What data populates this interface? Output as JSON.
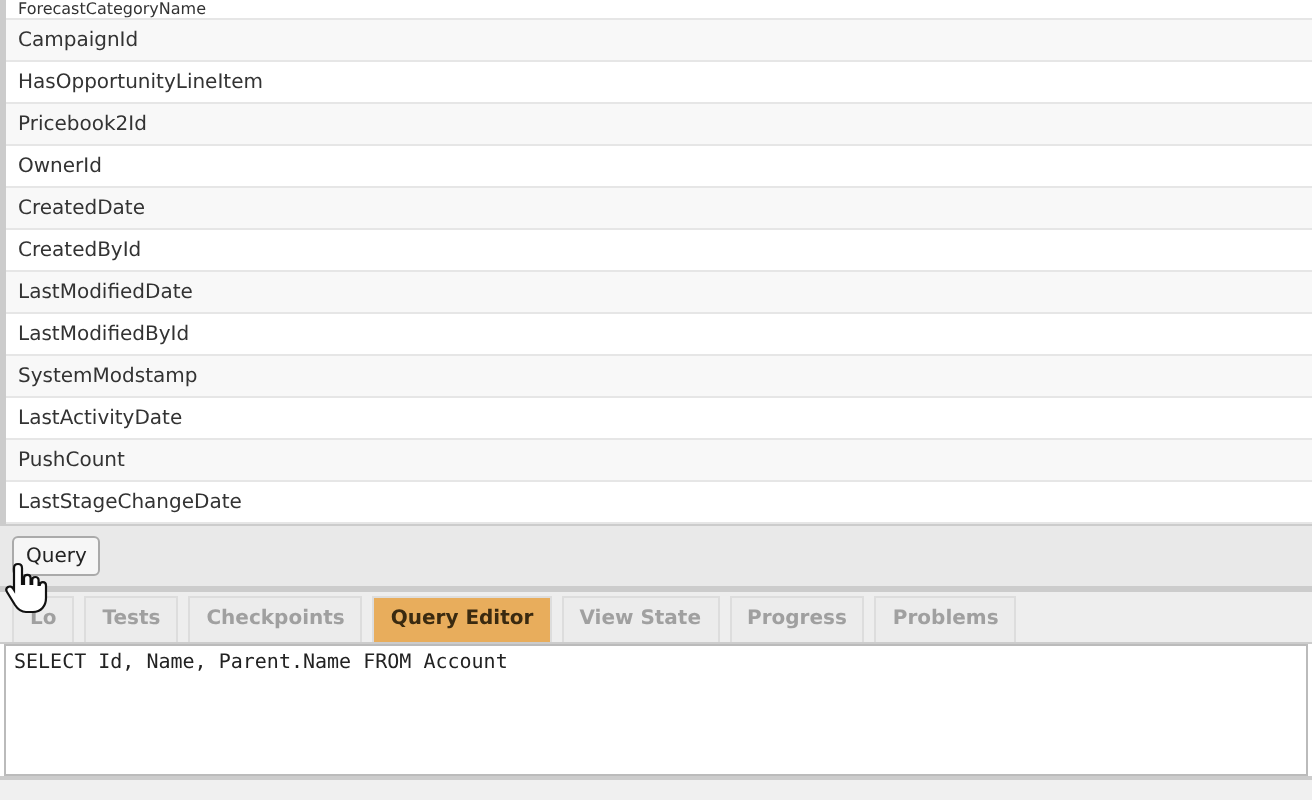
{
  "fields": [
    "ForecastCategoryName",
    "CampaignId",
    "HasOpportunityLineItem",
    "Pricebook2Id",
    "OwnerId",
    "CreatedDate",
    "CreatedById",
    "LastModifiedDate",
    "LastModifiedById",
    "SystemModstamp",
    "LastActivityDate",
    "PushCount",
    "LastStageChangeDate"
  ],
  "query_button": "Query",
  "tabs": [
    {
      "label": "Lo",
      "selected": false
    },
    {
      "label": "Tests",
      "selected": false
    },
    {
      "label": "Checkpoints",
      "selected": false
    },
    {
      "label": "Query Editor",
      "selected": true
    },
    {
      "label": "View State",
      "selected": false
    },
    {
      "label": "Progress",
      "selected": false
    },
    {
      "label": "Problems",
      "selected": false
    }
  ],
  "editor": {
    "value": "SELECT Id, Name, Parent.Name FROM Account"
  }
}
